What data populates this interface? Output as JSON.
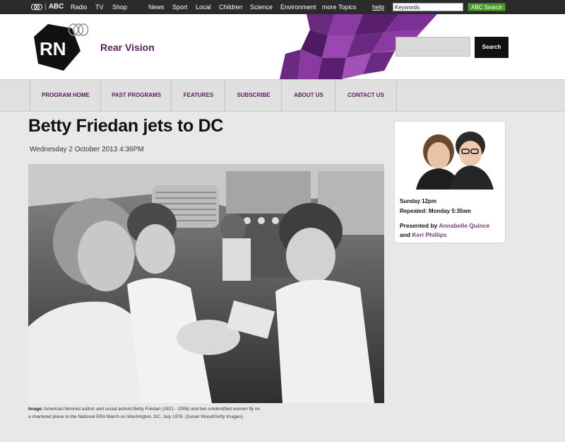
{
  "abc_bar": {
    "logo_text": "ABC",
    "links": [
      "Radio",
      "TV",
      "Shop",
      "News",
      "Sport",
      "Local",
      "Children",
      "Science",
      "Environment",
      "more Topics"
    ],
    "help": "help",
    "keywords_value": "Keywords",
    "search_button": "ABC Search"
  },
  "header": {
    "logo_text": "RN",
    "program_title": "Rear Vision",
    "search_button": "Search",
    "accent_color": "#5a1e5c"
  },
  "nav": [
    "PROGRAM HOME",
    "PAST PROGRAMS",
    "FEATURES",
    "SUBSCRIBE",
    "ABOUT US",
    "CONTACT US"
  ],
  "article": {
    "headline": "Betty Friedan jets to DC",
    "date": "Wednesday 2 October 2013 4:36PM",
    "caption_label": "Image:",
    "caption_text": " American feminist author and social activist Betty Friedan (1921 - 2006) and two unidentified women fly on a chartered plane to the National ERA March on Washington, DC, July 1978. (Susan Wood/Getty Images)"
  },
  "program_card": {
    "time": "Sunday 12pm",
    "repeated": "Repeated: Monday 5:30am",
    "presented_by": "Presented by ",
    "presenter1": "Annabelle Quince",
    "and": "and ",
    "presenter2": "Keri Phillips"
  }
}
